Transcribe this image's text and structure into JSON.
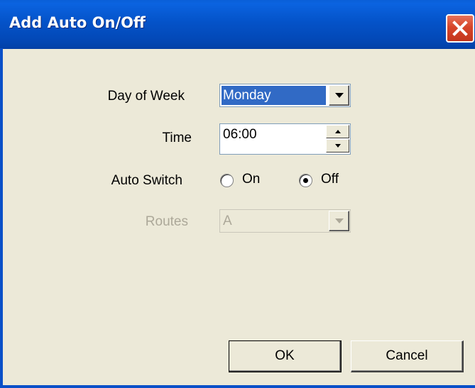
{
  "window": {
    "title": "Add Auto On/Off"
  },
  "form": {
    "day_of_week": {
      "label": "Day of Week",
      "value": "Monday"
    },
    "time": {
      "label": "Time",
      "value": "06:00"
    },
    "auto_switch": {
      "label": "Auto Switch",
      "options": [
        {
          "label": "On",
          "selected": false
        },
        {
          "label": "Off",
          "selected": true
        }
      ]
    },
    "routes": {
      "label": "Routes",
      "value": "A",
      "enabled": false
    }
  },
  "buttons": {
    "ok_label": "OK",
    "cancel_label": "Cancel"
  },
  "colors": {
    "titlebar": "#0453c9",
    "selection": "#316ac5",
    "dialog_bg": "#ece9d8",
    "close_button": "#d6452a"
  },
  "icons": {
    "close": "close-icon",
    "dropdown": "chevron-down-icon",
    "spin_up": "spin-up-icon",
    "spin_down": "spin-down-icon"
  }
}
